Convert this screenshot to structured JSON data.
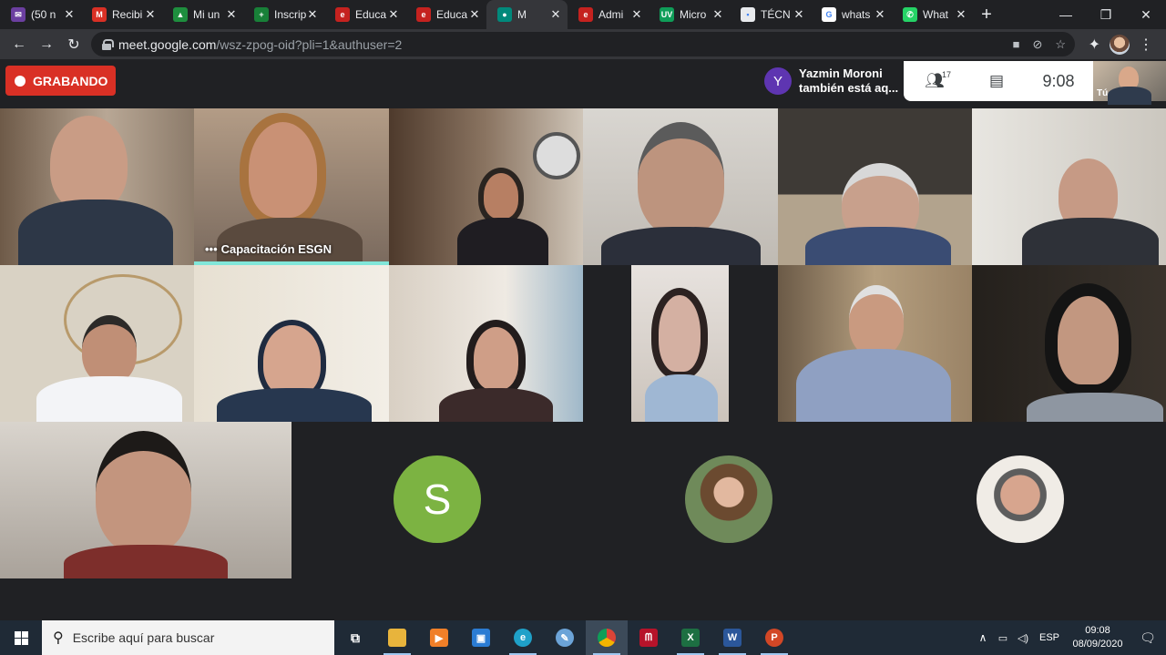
{
  "browser": {
    "tabs": [
      {
        "title": "(50 n",
        "favicon_color": "#6b3fa0",
        "glyph": "✉"
      },
      {
        "title": "Recibi",
        "favicon_color": "#d93025",
        "glyph": "M"
      },
      {
        "title": "Mi un",
        "favicon_color": "#1e8e3e",
        "glyph": "▲"
      },
      {
        "title": "Inscrip",
        "favicon_color": "#188038",
        "glyph": "+"
      },
      {
        "title": "Educa",
        "favicon_color": "#c5221f",
        "glyph": "e"
      },
      {
        "title": "Educa",
        "favicon_color": "#c5221f",
        "glyph": "e"
      },
      {
        "title": "M",
        "favicon_color": "#00897b",
        "glyph": "●",
        "active": true
      },
      {
        "title": "Admi",
        "favicon_color": "#c5221f",
        "glyph": "e"
      },
      {
        "title": "Micro",
        "favicon_color": "#0f9d58",
        "glyph": "UV"
      },
      {
        "title": "TÉCN",
        "favicon_color": "#e8eaed",
        "glyph": "▪"
      },
      {
        "title": "whats",
        "favicon_color": "#ffffff",
        "glyph": "G"
      },
      {
        "title": "What",
        "favicon_color": "#25d366",
        "glyph": "✆"
      }
    ],
    "url_host": "meet.google.com",
    "url_path": "/wsz-zpog-oid?pli=1&authuser=2"
  },
  "meet": {
    "recording_label": "GRABANDO",
    "notification": {
      "initial": "Y",
      "line1": "Yazmin Moroni",
      "line2": "también está aq..."
    },
    "participants_count": "17",
    "clock": "9:08",
    "self_label": "Tú",
    "speaker_name": "Capacitación ESGN",
    "avatar_letter": "S"
  },
  "taskbar": {
    "search_placeholder": "Escribe aquí para buscar",
    "language": "ESP",
    "time": "09:08",
    "date": "08/09/2020"
  }
}
